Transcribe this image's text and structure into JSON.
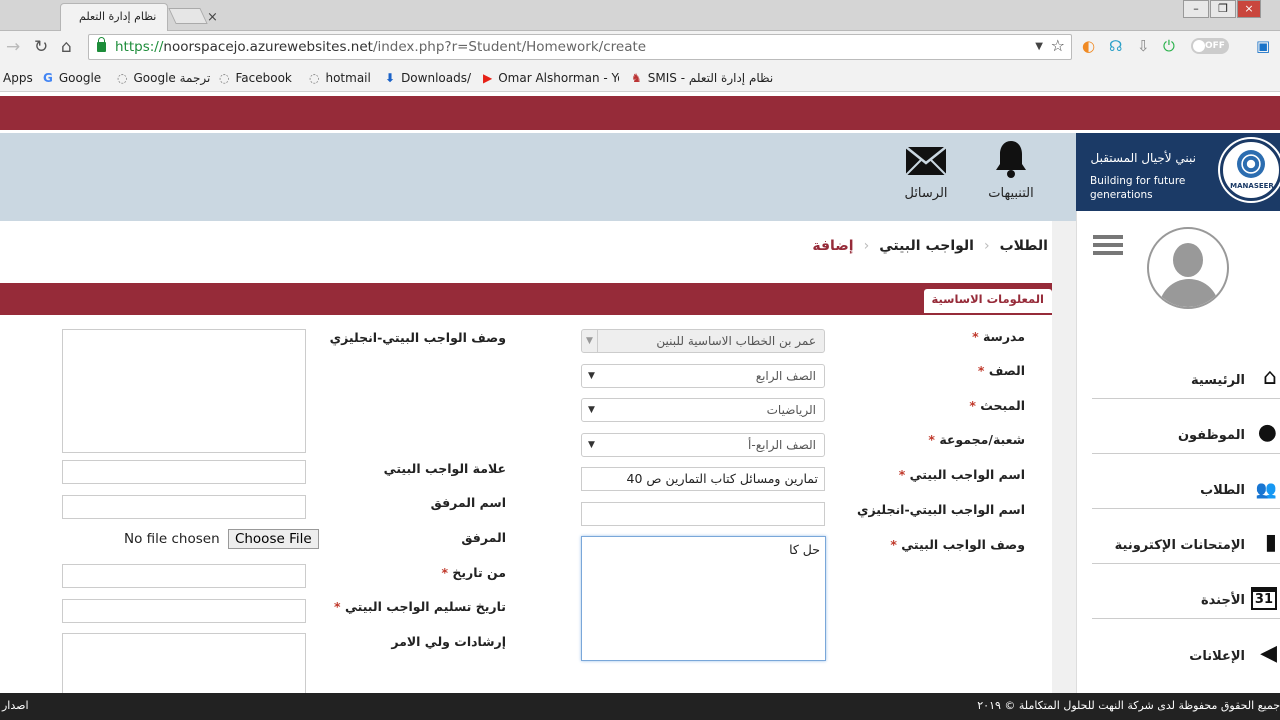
{
  "browser": {
    "tab_title": "نظام إدارة التعلم",
    "tab_close": "×",
    "url_scheme": "https://",
    "url_host": "noorspacejo.azurewebsites.net",
    "url_path": "/index.php?r=Student/Homework/create",
    "extension_toggle": "OFF",
    "bookmarks": [
      "Apps",
      "Google",
      "Google ترجمة",
      "Facebook",
      "hotmail",
      "Downloads/",
      "Omar Alshorman - Yo",
      "SMIS - نظام إدارة التعلم"
    ]
  },
  "header": {
    "notifications_label": "التنبيهات",
    "messages_label": "الرسائل"
  },
  "logo": {
    "arabic": "نبني لأجيال المستقبل",
    "english": "Building for future generations",
    "brand": "MANASEER"
  },
  "sidebar": {
    "items": [
      {
        "label": "الرئيسية",
        "icon": "home-icon"
      },
      {
        "label": "الموظفون",
        "icon": "user-icon"
      },
      {
        "label": "الطلاب",
        "icon": "students-icon"
      },
      {
        "label": "الإمتحانات الإكترونية",
        "icon": "exam-icon"
      },
      {
        "label": "الأجندة",
        "icon": "calendar-icon"
      },
      {
        "label": "الإعلانات",
        "icon": "megaphone-icon"
      }
    ],
    "calendar_day": "31"
  },
  "breadcrumb": {
    "students": "الطلاب",
    "homework": "الواجب البيتي",
    "add": "إضافة"
  },
  "section_title": "المعلومات الاساسية",
  "form": {
    "school_label": "مدرسة",
    "school_value": "عمر بن الخطاب الاساسية للبنين",
    "grade_label": "الصف",
    "grade_value": "الصف الرابع",
    "subject_label": "المبحث",
    "subject_value": "الرياضيات",
    "section_label": "شعبة/مجموعة",
    "section_value": "الصف الرابع-أ",
    "hw_name_label": "اسم الواجب البيتي",
    "hw_name_value": "تمارين ومسائل كتاب التمارين ص 40",
    "hw_name_en_label": "اسم الواجب البيتي-انجليزي",
    "hw_name_en_value": "",
    "hw_desc_label": "وصف الواجب البيتي",
    "hw_desc_value": "حل كا",
    "hw_desc_en_label": "وصف الواجب البيتي-انجليزي",
    "hw_mark_label": "علامة الواجب البيتي",
    "attachment_name_label": "اسم المرفق",
    "attachment_label": "المرفق",
    "no_file": "No file chosen",
    "choose_file": "Choose File",
    "from_date_label": "من تاريخ",
    "due_date_label": "تاريخ تسليم الواجب البيتي",
    "guardian_label": "إرشادات ولي الامر",
    "required_mark": "*"
  },
  "footer": {
    "copyright": "جميع الحقوق محفوظة لدى شركة النهت للحلول المتكاملة © ٢٠١٩",
    "version": "اصدار"
  }
}
